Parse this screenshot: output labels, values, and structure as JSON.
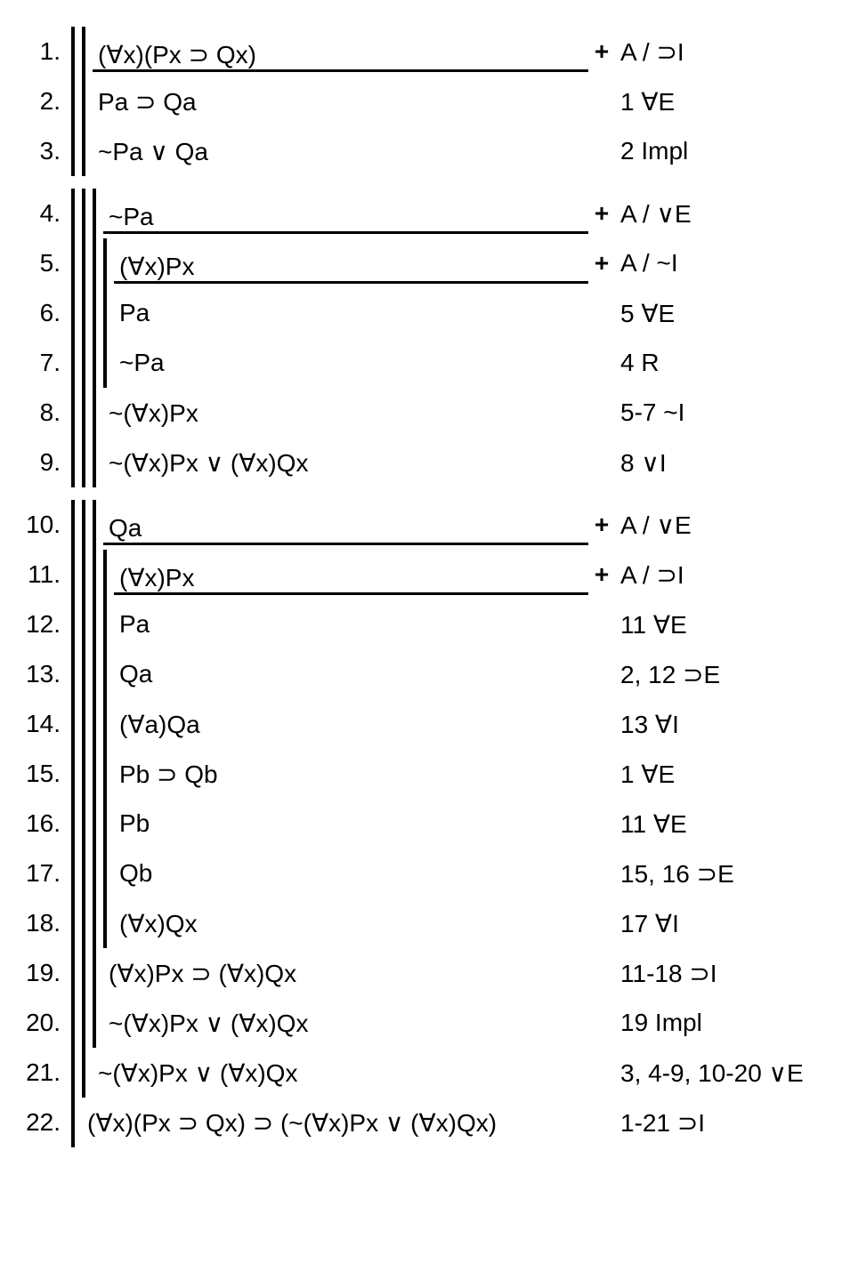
{
  "lines": [
    {
      "n": "1.",
      "depth": 2,
      "formula": "(∀x)(Px ⊃ Qx)",
      "plus": "+",
      "just": "A / ⊃I",
      "assumption": true
    },
    {
      "n": "2.",
      "depth": 2,
      "formula": "Pa ⊃ Qa",
      "plus": "",
      "just": "1 ∀E",
      "assumption": false
    },
    {
      "n": "3.",
      "depth": 2,
      "formula": "~Pa ∨ Qa",
      "plus": "",
      "just": "2 Impl",
      "assumption": false
    },
    {
      "gap": true
    },
    {
      "n": "4.",
      "depth": 3,
      "formula": "~Pa",
      "plus": "+",
      "just": "A / ∨E",
      "assumption": true
    },
    {
      "n": "5.",
      "depth": 4,
      "formula": "(∀x)Px",
      "plus": "+",
      "just": "A / ~I",
      "assumption": true
    },
    {
      "n": "6.",
      "depth": 4,
      "formula": "Pa",
      "plus": "",
      "just": "5 ∀E",
      "assumption": false
    },
    {
      "n": "7.",
      "depth": 4,
      "formula": "~Pa",
      "plus": "",
      "just": "4 R",
      "assumption": false
    },
    {
      "n": "8.",
      "depth": 3,
      "formula": "~(∀x)Px",
      "plus": "",
      "just": "5-7 ~I",
      "assumption": false
    },
    {
      "n": "9.",
      "depth": 3,
      "formula": "~(∀x)Px ∨ (∀x)Qx",
      "plus": "",
      "just": "8 ∨I",
      "assumption": false
    },
    {
      "gap": true
    },
    {
      "n": "10.",
      "depth": 3,
      "formula": "Qa",
      "plus": "+",
      "just": "A / ∨E",
      "assumption": true
    },
    {
      "n": "11.",
      "depth": 4,
      "formula": "(∀x)Px",
      "plus": "+",
      "just": "A / ⊃I",
      "assumption": true
    },
    {
      "n": "12.",
      "depth": 4,
      "formula": "Pa",
      "plus": "",
      "just": "11 ∀E",
      "assumption": false
    },
    {
      "n": "13.",
      "depth": 4,
      "formula": "Qa",
      "plus": "",
      "just": "2, 12 ⊃E",
      "assumption": false
    },
    {
      "n": "14.",
      "depth": 4,
      "formula": "(∀a)Qa",
      "plus": "",
      "just": "13 ∀I",
      "assumption": false
    },
    {
      "n": "15.",
      "depth": 4,
      "formula": "Pb ⊃ Qb",
      "plus": "",
      "just": "1 ∀E",
      "assumption": false
    },
    {
      "n": "16.",
      "depth": 4,
      "formula": "Pb",
      "plus": "",
      "just": "11 ∀E",
      "assumption": false
    },
    {
      "n": "17.",
      "depth": 4,
      "formula": "Qb",
      "plus": "",
      "just": "15, 16 ⊃E",
      "assumption": false
    },
    {
      "n": "18.",
      "depth": 4,
      "formula": "(∀x)Qx",
      "plus": "",
      "just": "17 ∀I",
      "assumption": false
    },
    {
      "n": "19.",
      "depth": 3,
      "formula": "(∀x)Px ⊃ (∀x)Qx",
      "plus": "",
      "just": "11-18 ⊃I",
      "assumption": false
    },
    {
      "n": "20.",
      "depth": 3,
      "formula": "~(∀x)Px ∨ (∀x)Qx",
      "plus": "",
      "just": "19 Impl",
      "assumption": false
    },
    {
      "n": "21.",
      "depth": 2,
      "formula": "~(∀x)Px ∨ (∀x)Qx",
      "plus": "",
      "just": "3, 4-9, 10-20 ∨E",
      "assumption": false
    },
    {
      "n": "22.",
      "depth": 1,
      "formula": "(∀x)(Px ⊃ Qx) ⊃ (~(∀x)Px ∨ (∀x)Qx)",
      "plus": "",
      "just": "1-21 ⊃I",
      "assumption": false
    }
  ]
}
